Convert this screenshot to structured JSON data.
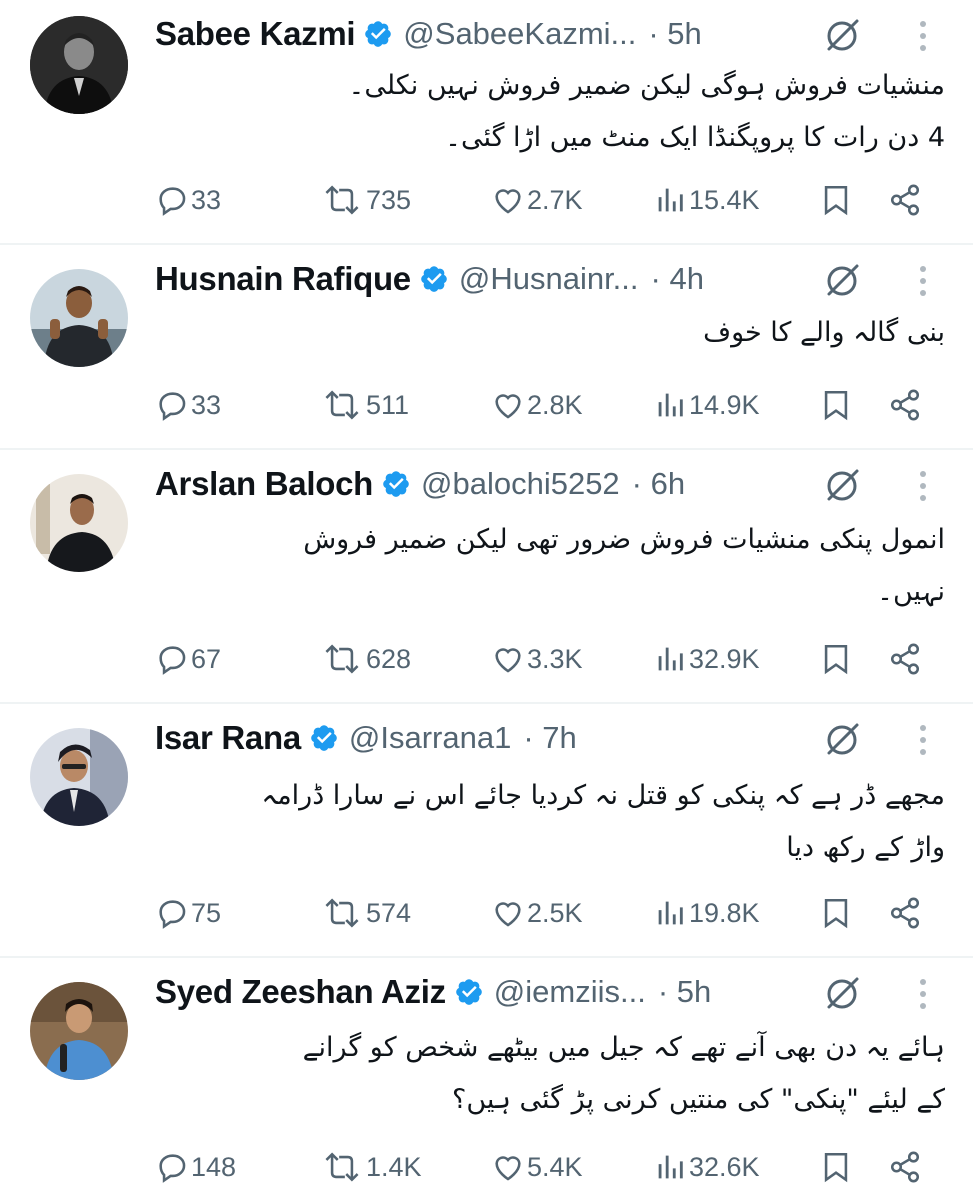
{
  "tweets": [
    {
      "name": "Sabee Kazmi",
      "handle": "@SabeeKazmi...",
      "time": "· 5h",
      "text_lines": [
        "منشیات فروش ہوگی لیکن ضمیر فروش نہیں نکلی۔",
        "4 دن رات کا پروپگنڈا ایک منٹ میں اڑا گئی۔"
      ],
      "replies": "33",
      "reposts": "735",
      "likes": "2.7K",
      "views": "15.4K"
    },
    {
      "name": "Husnain Rafique",
      "handle": "@Husnainr...",
      "time": "· 4h",
      "text_lines": [
        "بنی گالہ والے کا خوف"
      ],
      "replies": "33",
      "reposts": "511",
      "likes": "2.8K",
      "views": "14.9K"
    },
    {
      "name": "Arslan Baloch",
      "handle": "@balochi5252",
      "time": "· 6h",
      "text_lines": [
        "انمول پنکی منشیات فروش ضرور تھی لیکن ضمیر فروش",
        "نہیں۔"
      ],
      "replies": "67",
      "reposts": "628",
      "likes": "3.3K",
      "views": "32.9K"
    },
    {
      "name": "Isar Rana",
      "handle": "@Isarrana1",
      "time": "· 7h",
      "text_lines": [
        "مجھے ڈر ہے کہ پنکی کو قتل نہ کردیا جائے اس نے سارا ڈرامہ",
        "واڑ کے رکھ دیا"
      ],
      "replies": "75",
      "reposts": "574",
      "likes": "2.5K",
      "views": "19.8K"
    },
    {
      "name": "Syed Zeeshan Aziz",
      "handle": "@iemziis...",
      "time": "· 5h",
      "text_lines": [
        "ہائے یہ دن بھی آنے تھے کہ جیل میں بیٹھے شخص کو گرانے",
        "کے لیئے \"پنکی\" کی منتیں کرنی پڑ گئی ہیں؟"
      ],
      "replies": "148",
      "reposts": "1.4K",
      "likes": "5.4K",
      "views": "32.6K"
    }
  ],
  "icons": {
    "reply": "reply-icon",
    "repost": "repost-icon",
    "like": "like-icon",
    "views": "views-icon",
    "bookmark": "bookmark-icon",
    "share": "share-icon",
    "grok": "grok-icon",
    "more": "more-icon",
    "verified": "verified-badge-icon"
  },
  "colors": {
    "text": "#0f1419",
    "secondary": "#536471",
    "verified": "#1d9bf0",
    "divider": "#eff3f4"
  }
}
